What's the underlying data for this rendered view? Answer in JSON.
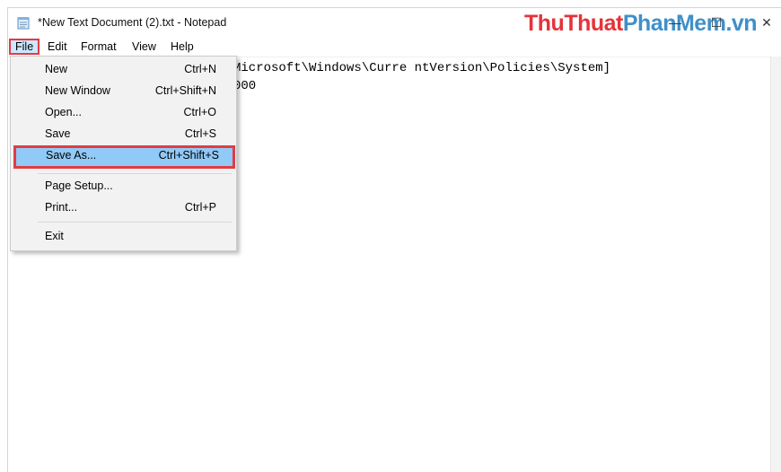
{
  "window": {
    "title": "*New Text Document (2).txt - Notepad",
    "minimize_glyph": "—",
    "maximize_glyph": "☐",
    "close_glyph": "✕"
  },
  "watermark": {
    "part1": "ThuThuat",
    "part2": "PhanMem",
    "part3": ".vn"
  },
  "menubar": {
    "file": "File",
    "edit": "Edit",
    "format": "Format",
    "view": "View",
    "help": "Help"
  },
  "file_menu": {
    "new": {
      "label": "New",
      "shortcut": "Ctrl+N"
    },
    "new_window": {
      "label": "New Window",
      "shortcut": "Ctrl+Shift+N"
    },
    "open": {
      "label": "Open...",
      "shortcut": "Ctrl+O"
    },
    "save": {
      "label": "Save",
      "shortcut": "Ctrl+S"
    },
    "save_as": {
      "label": "Save As...",
      "shortcut": "Ctrl+Shift+S"
    },
    "page_setup": {
      "label": "Page Setup...",
      "shortcut": ""
    },
    "print": {
      "label": "Print...",
      "shortcut": "Ctrl+P"
    },
    "exit": {
      "label": "Exit",
      "shortcut": ""
    }
  },
  "editor": {
    "line1": "Microsoft\\Windows\\Curre ntVersion\\Policies\\System]",
    "line2": "000"
  },
  "colors": {
    "highlight_border": "#e33b42",
    "highlight_fill": "#91c9f7",
    "menu_active_fill": "#cce8ff",
    "watermark_red": "#e5333a",
    "watermark_blue": "#3f90c9"
  },
  "icons": {
    "app": "notepad-icon"
  }
}
